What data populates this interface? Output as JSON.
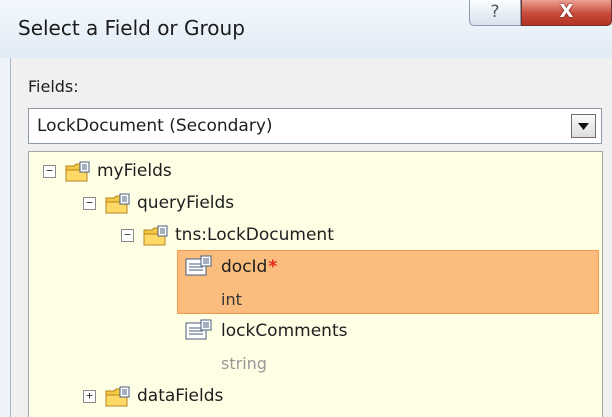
{
  "window": {
    "title": "Select a Field or Group",
    "help_glyph": "?",
    "close_glyph": "X"
  },
  "fields": {
    "label": "Fields:",
    "selected_source": "LockDocument (Secondary)"
  },
  "tree": {
    "myFields": {
      "label": "myFields",
      "expander": "−"
    },
    "queryFields": {
      "label": "queryFields",
      "expander": "−"
    },
    "lockDocument": {
      "label": "tns:LockDocument",
      "expander": "−"
    },
    "docId": {
      "label": "docId",
      "required": "*",
      "type": "int",
      "selected": true
    },
    "lockComments": {
      "label": "lockComments",
      "type": "string"
    },
    "dataFields": {
      "label": "dataFields",
      "expander": "+"
    }
  },
  "colors": {
    "selection_fill": "#fbbd7d",
    "selection_border": "#f09b4e",
    "tree_background": "#fefee5",
    "required_marker": "#e0241c",
    "close_button": "#c7493a"
  },
  "icons": {
    "group": "folder-with-document-icon",
    "field": "field-element-icon",
    "combo_arrow": "dropdown-arrow-icon"
  }
}
